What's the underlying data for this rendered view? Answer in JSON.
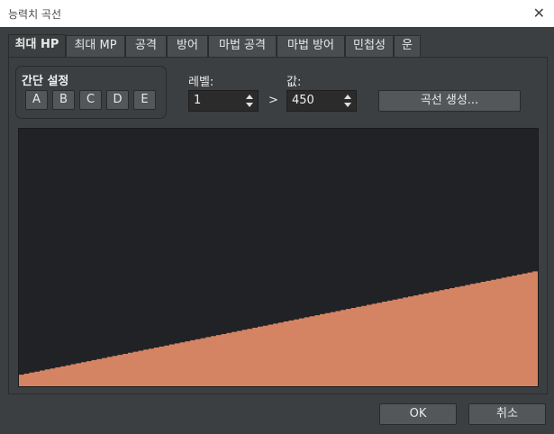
{
  "window": {
    "title": "능력치 곡선",
    "close_label": "✕"
  },
  "tabs": [
    {
      "label": "최대 HP",
      "active": true
    },
    {
      "label": "최대 MP",
      "active": false
    },
    {
      "label": "공격",
      "active": false
    },
    {
      "label": "방어",
      "active": false
    },
    {
      "label": "마법 공격",
      "active": false
    },
    {
      "label": "마법 방어",
      "active": false
    },
    {
      "label": "민첩성",
      "active": false
    },
    {
      "label": "운",
      "active": false
    }
  ],
  "quick_setting": {
    "title": "간단 설정",
    "buttons": [
      "A",
      "B",
      "C",
      "D",
      "E"
    ]
  },
  "level": {
    "label": "레벨:",
    "value": "1"
  },
  "arrow": ">",
  "value_field": {
    "label": "값:",
    "value": "450"
  },
  "generate_button": "곡선 생성...",
  "footer": {
    "ok_label": "OK",
    "cancel_label": "취소"
  },
  "colors": {
    "curve_fill": "#d58463",
    "chart_bg": "#202226"
  },
  "chart_data": {
    "type": "area",
    "series": [
      {
        "x": [
          1,
          99
        ],
        "values": [
          450,
          4500
        ]
      }
    ],
    "xlim": [
      1,
      99
    ],
    "ylim": [
      0,
      9999
    ]
  }
}
